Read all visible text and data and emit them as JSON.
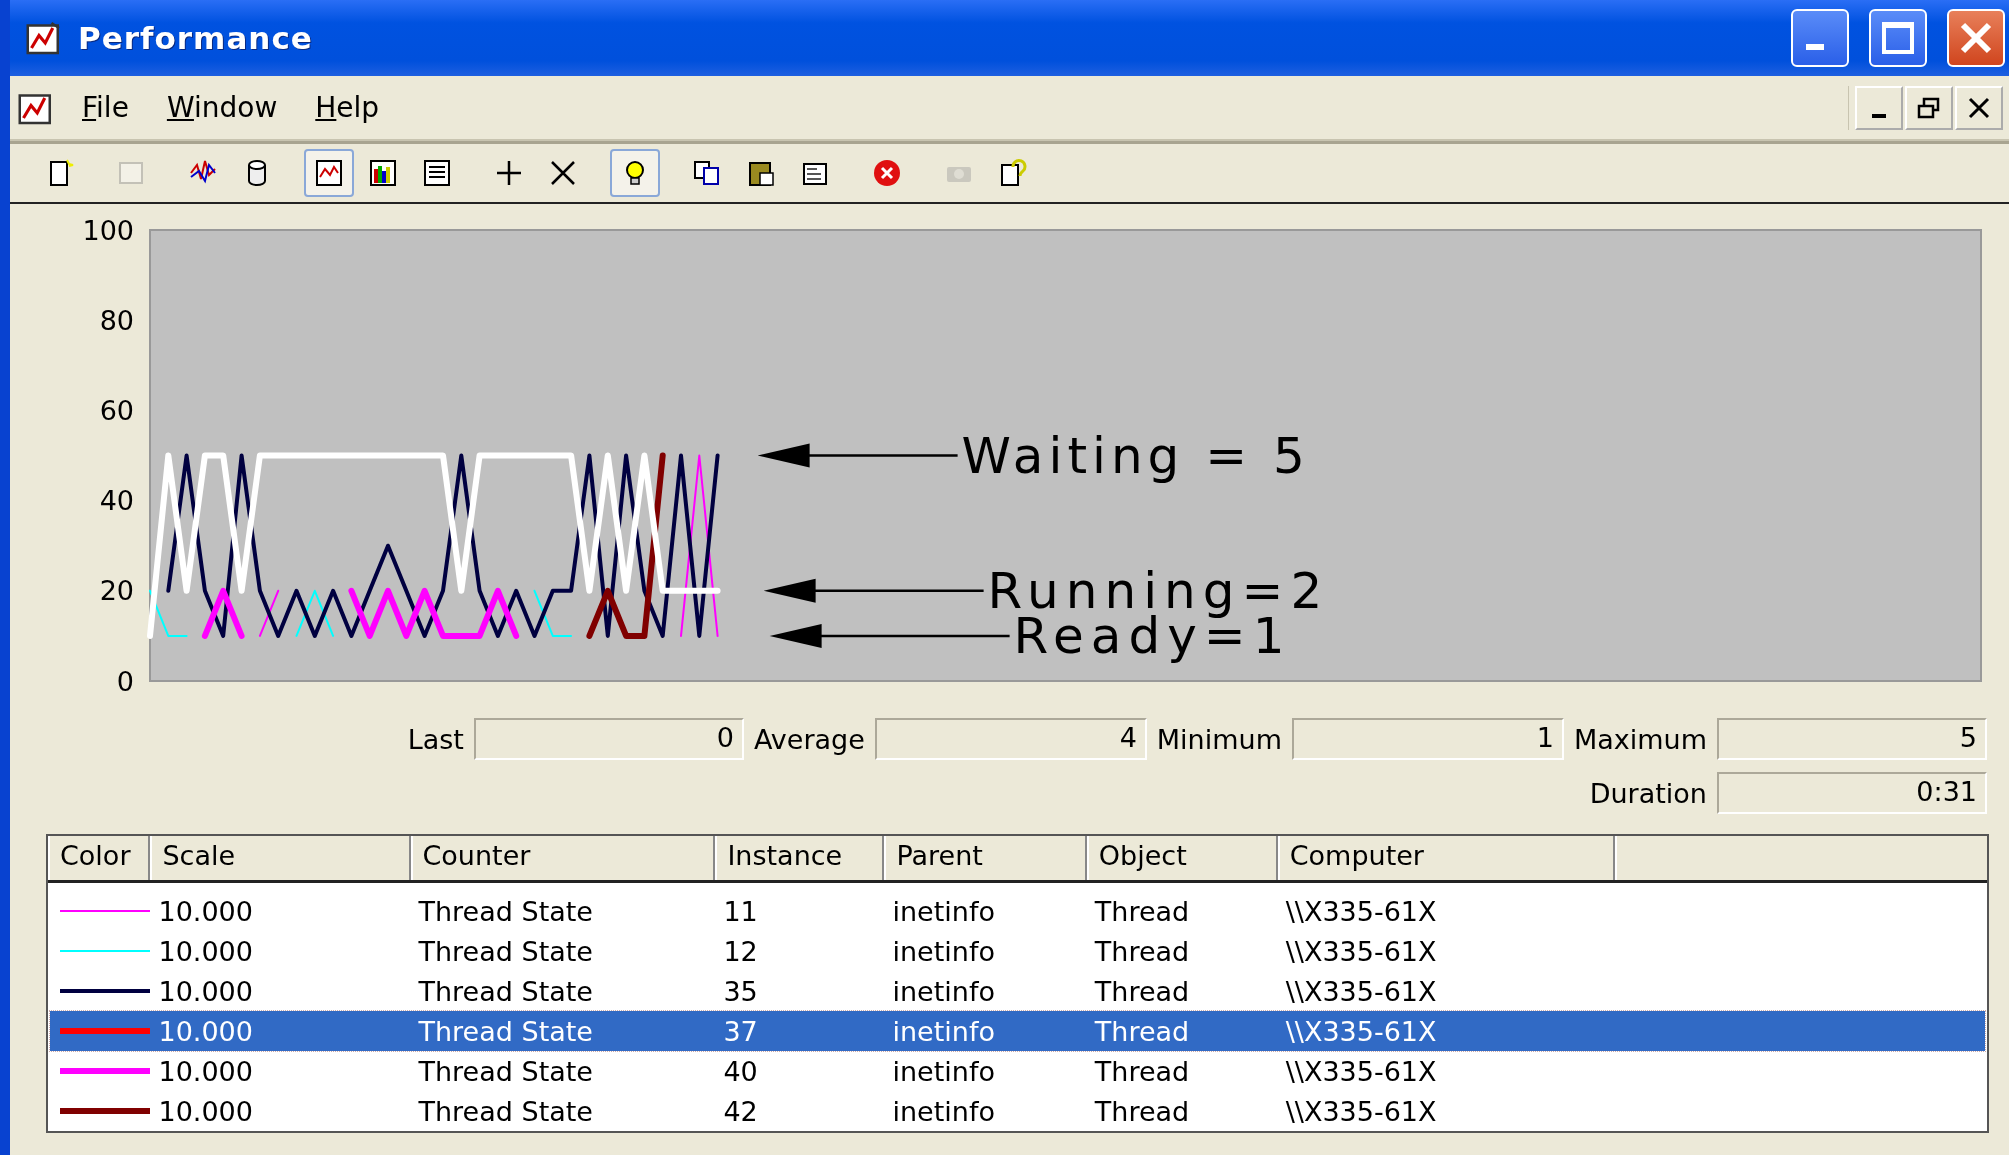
{
  "window": {
    "title": "Performance"
  },
  "menu": [
    "File",
    "Window",
    "Help"
  ],
  "toolbar": [
    {
      "kind": "new",
      "pressed": false,
      "disabled": false
    },
    {
      "kind": "clear",
      "pressed": false,
      "disabled": true
    },
    {
      "kind": "current",
      "pressed": false,
      "disabled": false
    },
    {
      "kind": "log",
      "pressed": false,
      "disabled": false
    },
    {
      "kind": "graph",
      "pressed": true,
      "disabled": false
    },
    {
      "kind": "histogram",
      "pressed": false,
      "disabled": false
    },
    {
      "kind": "report",
      "pressed": false,
      "disabled": false
    },
    {
      "kind": "add",
      "pressed": false,
      "disabled": false
    },
    {
      "kind": "delete",
      "pressed": false,
      "disabled": false
    },
    {
      "kind": "highlight",
      "pressed": true,
      "disabled": false
    },
    {
      "kind": "copy",
      "pressed": false,
      "disabled": false
    },
    {
      "kind": "paste",
      "pressed": false,
      "disabled": false
    },
    {
      "kind": "properties",
      "pressed": false,
      "disabled": false
    },
    {
      "kind": "freeze",
      "pressed": false,
      "disabled": false
    },
    {
      "kind": "update",
      "pressed": false,
      "disabled": true
    },
    {
      "kind": "help",
      "pressed": false,
      "disabled": false
    }
  ],
  "graph": {
    "chart_data": {
      "type": "line",
      "ylim": [
        0,
        100
      ],
      "yticks": [
        0,
        20,
        40,
        60,
        80,
        100
      ],
      "categories": [
        null,
        null,
        null,
        null,
        null,
        null,
        null,
        null,
        null,
        null,
        null,
        null,
        null,
        null,
        null,
        null,
        null,
        null,
        null,
        null,
        null,
        null,
        null,
        null,
        null,
        null,
        null,
        null,
        null,
        null,
        null,
        null
      ],
      "series": [
        {
          "color": "#ff00ff",
          "values": [
            null,
            null,
            null,
            null,
            null,
            null,
            10,
            20,
            null,
            null,
            null,
            null,
            null,
            null,
            null,
            null,
            null,
            null,
            null,
            null,
            null,
            null,
            null,
            null,
            null,
            null,
            null,
            null,
            null,
            10,
            50,
            10
          ]
        },
        {
          "color": "#00ffff",
          "values": [
            20,
            10,
            10,
            null,
            null,
            null,
            null,
            null,
            10,
            20,
            10,
            null,
            null,
            null,
            null,
            null,
            null,
            null,
            null,
            null,
            null,
            20,
            10,
            10,
            null,
            null,
            null,
            null,
            null,
            null,
            null,
            null
          ]
        },
        {
          "color": "#000040",
          "values": [
            null,
            20,
            50,
            20,
            10,
            50,
            20,
            10,
            20,
            10,
            20,
            10,
            20,
            30,
            20,
            10,
            20,
            50,
            20,
            10,
            20,
            10,
            20,
            20,
            50,
            10,
            50,
            20,
            10,
            50,
            10,
            50
          ]
        },
        {
          "color": "#ffffff",
          "values": [
            10,
            50,
            20,
            50,
            50,
            20,
            50,
            50,
            50,
            50,
            50,
            50,
            50,
            50,
            50,
            50,
            50,
            20,
            50,
            50,
            50,
            50,
            50,
            50,
            20,
            50,
            20,
            50,
            20,
            20,
            20,
            20
          ]
        },
        {
          "color": "#ff00ff",
          "values": [
            null,
            null,
            null,
            10,
            20,
            10,
            null,
            null,
            null,
            null,
            null,
            20,
            10,
            20,
            10,
            20,
            10,
            10,
            10,
            20,
            10,
            null,
            null,
            null,
            null,
            null,
            null,
            null,
            null,
            null,
            null,
            null
          ]
        },
        {
          "color": "#800000",
          "values": [
            null,
            null,
            null,
            null,
            null,
            null,
            null,
            null,
            null,
            null,
            null,
            null,
            null,
            null,
            null,
            null,
            null,
            null,
            null,
            null,
            null,
            null,
            null,
            null,
            10,
            20,
            10,
            10,
            50,
            null,
            null,
            null
          ]
        }
      ]
    },
    "callouts": [
      "Waiting = 5",
      "Running=2",
      "Ready=1"
    ]
  },
  "stats": [
    {
      "label": "Last",
      "value": "0"
    },
    {
      "label": "Average",
      "value": "4"
    },
    {
      "label": "Minimum",
      "value": "1"
    },
    {
      "label": "Maximum",
      "value": "5"
    },
    {
      "label": "Duration",
      "value": "0:31"
    }
  ],
  "table": {
    "columns": [
      "Color",
      "Scale",
      "Counter",
      "Instance",
      "Parent",
      "Object",
      "Computer"
    ],
    "rows": [
      {
        "color": "#ff00ff",
        "kind": "thin",
        "selected": false,
        "cells": [
          "",
          "10.000",
          "Thread State",
          "11",
          "inetinfo",
          "Thread",
          "\\\\X335-61X"
        ]
      },
      {
        "color": "#00ffff",
        "kind": "thin",
        "selected": false,
        "cells": [
          "",
          "10.000",
          "Thread State",
          "12",
          "inetinfo",
          "Thread",
          "\\\\X335-61X"
        ]
      },
      {
        "color": "#000040",
        "kind": "medium",
        "selected": false,
        "cells": [
          "",
          "10.000",
          "Thread State",
          "35",
          "inetinfo",
          "Thread",
          "\\\\X335-61X"
        ]
      },
      {
        "color": "#ff0000",
        "kind": "thick",
        "selected": true,
        "cells": [
          "",
          "10.000",
          "Thread State",
          "37",
          "inetinfo",
          "Thread",
          "\\\\X335-61X"
        ]
      },
      {
        "color": "#ff00ff",
        "kind": "thick",
        "selected": false,
        "cells": [
          "",
          "10.000",
          "Thread State",
          "40",
          "inetinfo",
          "Thread",
          "\\\\X335-61X"
        ]
      },
      {
        "color": "#800000",
        "kind": "thick",
        "selected": false,
        "cells": [
          "",
          "10.000",
          "Thread State",
          "42",
          "inetinfo",
          "Thread",
          "\\\\X335-61X"
        ]
      }
    ]
  }
}
